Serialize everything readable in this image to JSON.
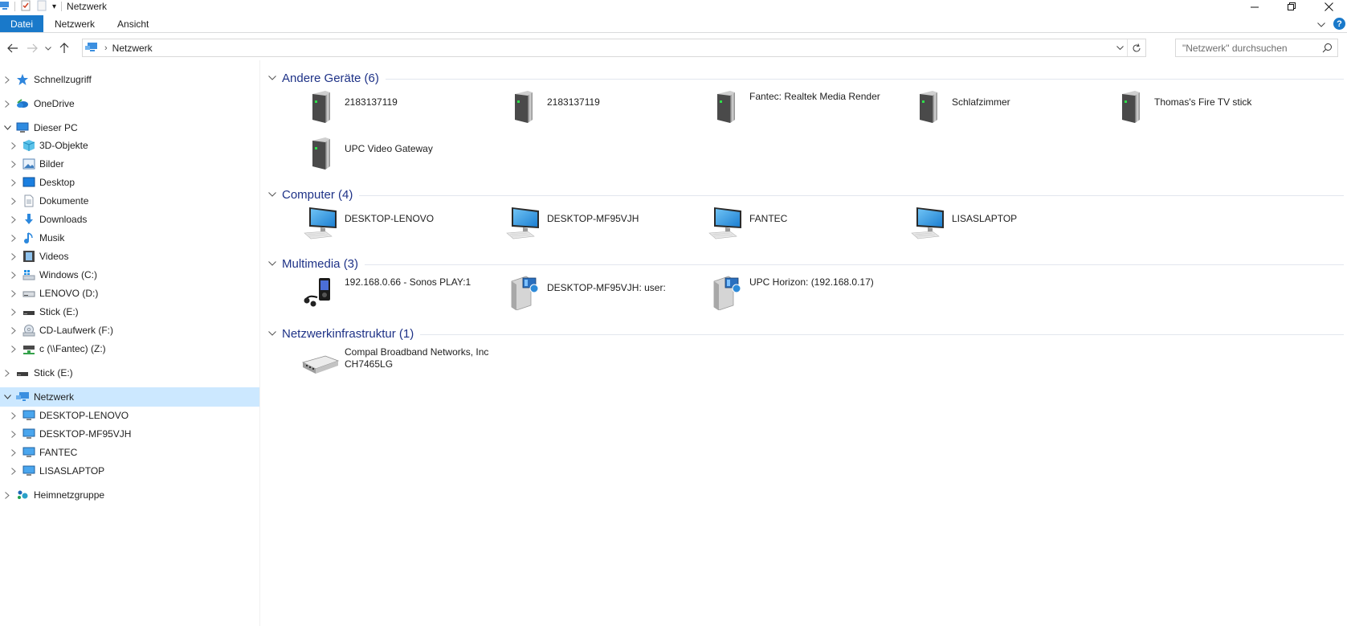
{
  "window": {
    "title": "Netzwerk",
    "qa_dropdown": "▾"
  },
  "ribbon": {
    "tabs": [
      {
        "label": "Datei"
      },
      {
        "label": "Netzwerk"
      },
      {
        "label": "Ansicht"
      }
    ],
    "help": "?"
  },
  "address": {
    "path": "Netzwerk",
    "search_placeholder": "\"Netzwerk\" durchsuchen"
  },
  "sidebar": {
    "items": [
      {
        "label": "Schnellzugriff",
        "icon": "star-icon"
      },
      {
        "label": "OneDrive",
        "icon": "cloud-icon"
      },
      {
        "label": "Dieser PC",
        "icon": "pc-icon"
      },
      {
        "label": "3D-Objekte",
        "icon": "cube-icon"
      },
      {
        "label": "Bilder",
        "icon": "pictures-icon"
      },
      {
        "label": "Desktop",
        "icon": "desktop-icon"
      },
      {
        "label": "Dokumente",
        "icon": "document-icon"
      },
      {
        "label": "Downloads",
        "icon": "download-icon"
      },
      {
        "label": "Musik",
        "icon": "music-icon"
      },
      {
        "label": "Videos",
        "icon": "video-icon"
      },
      {
        "label": "Windows (C:)",
        "icon": "windows-drive-icon"
      },
      {
        "label": "LENOVO (D:)",
        "icon": "drive-icon"
      },
      {
        "label": "Stick (E:)",
        "icon": "usb-drive-icon"
      },
      {
        "label": "CD-Laufwerk (F:)",
        "icon": "cd-drive-icon"
      },
      {
        "label": "c (\\\\Fantec) (Z:)",
        "icon": "network-drive-icon"
      },
      {
        "label": "Stick (E:)",
        "icon": "usb-drive-icon"
      },
      {
        "label": "Netzwerk",
        "icon": "network-icon"
      },
      {
        "label": "DESKTOP-LENOVO",
        "icon": "computer-icon"
      },
      {
        "label": "DESKTOP-MF95VJH",
        "icon": "computer-icon"
      },
      {
        "label": "FANTEC",
        "icon": "computer-icon"
      },
      {
        "label": "LISASLAPTOP",
        "icon": "computer-icon"
      },
      {
        "label": "Heimnetzgruppe",
        "icon": "homegroup-icon"
      }
    ]
  },
  "groups": [
    {
      "title": "Andere Geräte (6)",
      "items": [
        {
          "label": "2183137119",
          "icon": "media-device-icon"
        },
        {
          "label": "2183137119",
          "icon": "media-device-icon"
        },
        {
          "label": "Fantec: Realtek Media Render",
          "icon": "media-device-icon"
        },
        {
          "label": "Schlafzimmer",
          "icon": "media-device-icon"
        },
        {
          "label": "Thomas's Fire TV stick",
          "icon": "media-device-icon"
        },
        {
          "label": "UPC Video Gateway",
          "icon": "media-device-icon"
        }
      ]
    },
    {
      "title": "Computer (4)",
      "items": [
        {
          "label": "DESKTOP-LENOVO",
          "icon": "computer-icon"
        },
        {
          "label": "DESKTOP-MF95VJH",
          "icon": "computer-icon"
        },
        {
          "label": "FANTEC",
          "icon": "computer-icon"
        },
        {
          "label": "LISASLAPTOP",
          "icon": "computer-icon"
        }
      ]
    },
    {
      "title": "Multimedia (3)",
      "items": [
        {
          "label": "192.168.0.66 - Sonos PLAY:1",
          "icon": "media-player-icon"
        },
        {
          "label": "DESKTOP-MF95VJH: user:",
          "icon": "media-server-icon"
        },
        {
          "label": "UPC Horizon: (192.168.0.17)",
          "icon": "media-server-icon"
        }
      ]
    },
    {
      "title": "Netzwerkinfrastruktur (1)",
      "items": [
        {
          "label": "Compal Broadband Networks, Inc CH7465LG",
          "icon": "router-icon"
        }
      ]
    }
  ]
}
